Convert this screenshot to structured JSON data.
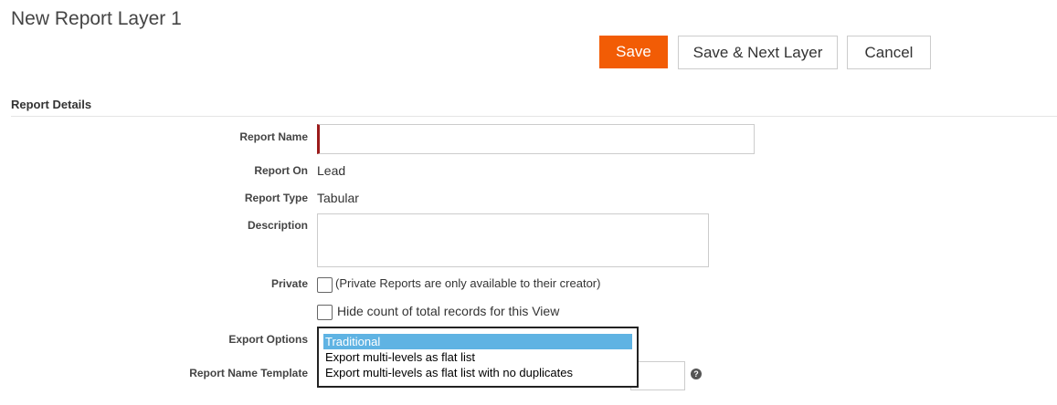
{
  "page": {
    "title": "New Report Layer 1"
  },
  "toolbar": {
    "save_label": "Save",
    "save_next_label": "Save & Next Layer",
    "cancel_label": "Cancel"
  },
  "section": {
    "title": "Report Details"
  },
  "fields": {
    "report_name": {
      "label": "Report Name",
      "value": ""
    },
    "report_on": {
      "label": "Report On",
      "value": "Lead"
    },
    "report_type": {
      "label": "Report Type",
      "value": "Tabular"
    },
    "description": {
      "label": "Description",
      "value": ""
    },
    "private": {
      "label": "Private",
      "text": "(Private Reports are only available to their creator)",
      "checked": false
    },
    "hide_count": {
      "text": "Hide count of total records for this View",
      "checked": false
    },
    "export_options": {
      "label": "Export Options",
      "options": [
        "Traditional",
        "Export multi-levels as flat list",
        "Export multi-levels as flat list with no duplicates"
      ],
      "selected": "Traditional"
    },
    "report_name_template": {
      "label": "Report Name Template",
      "value": ""
    }
  },
  "colors": {
    "accent": "#f25c05",
    "required_marker": "#9b1b1b",
    "selection": "#5fb3e3"
  },
  "icons": {
    "help": "question-circle-icon"
  }
}
